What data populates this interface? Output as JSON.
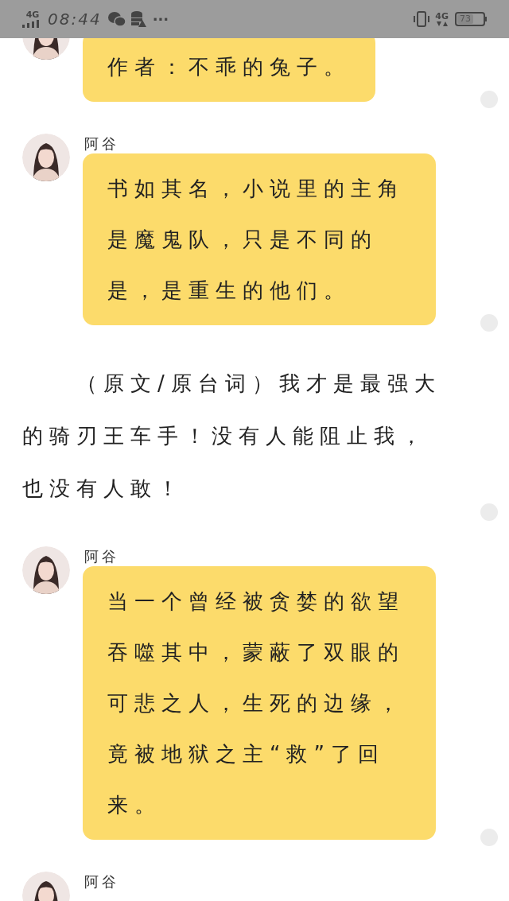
{
  "status_bar": {
    "network_left": "4G",
    "time": "08:44",
    "more": "···",
    "network_right": "4G",
    "battery": "73"
  },
  "items": [
    {
      "kind": "message",
      "text": "作者：不乖的兔子。"
    },
    {
      "kind": "message",
      "name": "阿谷",
      "text": "书如其名，小说里的主角是魔鬼队，只是不同的是，是重生的他们。"
    },
    {
      "kind": "paragraph",
      "text": "（原文/原台词）我才是最强大的骑刃王车手！没有人能阻止我，也没有人敢！"
    },
    {
      "kind": "message",
      "name": "阿谷",
      "text": "当一个曾经被贪婪的欲望吞噬其中，蒙蔽了双眼的可悲之人，生死的边缘，竟被地狱之主“救”了回来。"
    },
    {
      "kind": "message",
      "name": "阿谷"
    }
  ]
}
